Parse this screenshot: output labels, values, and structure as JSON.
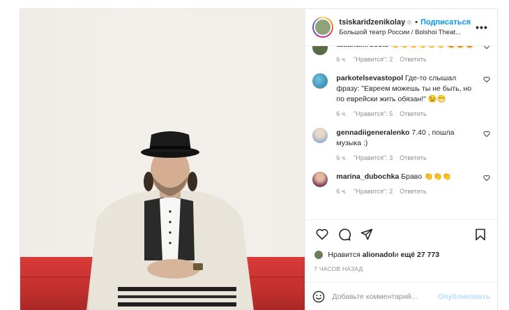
{
  "header": {
    "username": "tsiskaridzenikolay",
    "separator": "•",
    "follow_label": "Подписаться",
    "location": "Большой театр России / Bolshoi Theat...",
    "more_label": "•••"
  },
  "comments": [
    {
      "user": "tatianamrussia",
      "text": " 👏👏👏👏👏👏 🤩🤩🤩",
      "time": "6 ч.",
      "likes": "\"Нравится\": 2",
      "reply": "Ответить",
      "avatar_color": "#5a6b4a"
    },
    {
      "user": "parkotelsevastopol",
      "text": " Где-то слышал фразу: \"Евреем можешь ты не быть, но по еврейски жить обязан!\" 😉😁",
      "time": "6 ч.",
      "likes": "\"Нравится\": 5",
      "reply": "Ответить",
      "avatar_color": "#3a8fb0"
    },
    {
      "user": "gennadiigeneralenko",
      "text": " 7.40 , пошла музыка :)",
      "time": "6 ч.",
      "likes": "\"Нравится\": 3",
      "reply": "Ответить",
      "avatar_color": "#b7c6d6"
    },
    {
      "user": "marina_dubochka",
      "text": " Браво 👏👏👏",
      "time": "6 ч.",
      "likes": "\"Нравится\": 2",
      "reply": "Ответить",
      "avatar_color": "#8a5a66"
    }
  ],
  "likes_line": {
    "prefix": "Нравится ",
    "user": "alionadol",
    "middle": " и ",
    "rest": "ещё 27 773"
  },
  "timestamp": "7 ЧАСОВ НАЗАД",
  "add_comment": {
    "placeholder": "Добавьте комментарий...",
    "publish_label": "Опубликовать"
  },
  "colors": {
    "accent": "#0095f6",
    "publish_disabled": "#b2dffc",
    "meta": "#8e8e8e"
  }
}
